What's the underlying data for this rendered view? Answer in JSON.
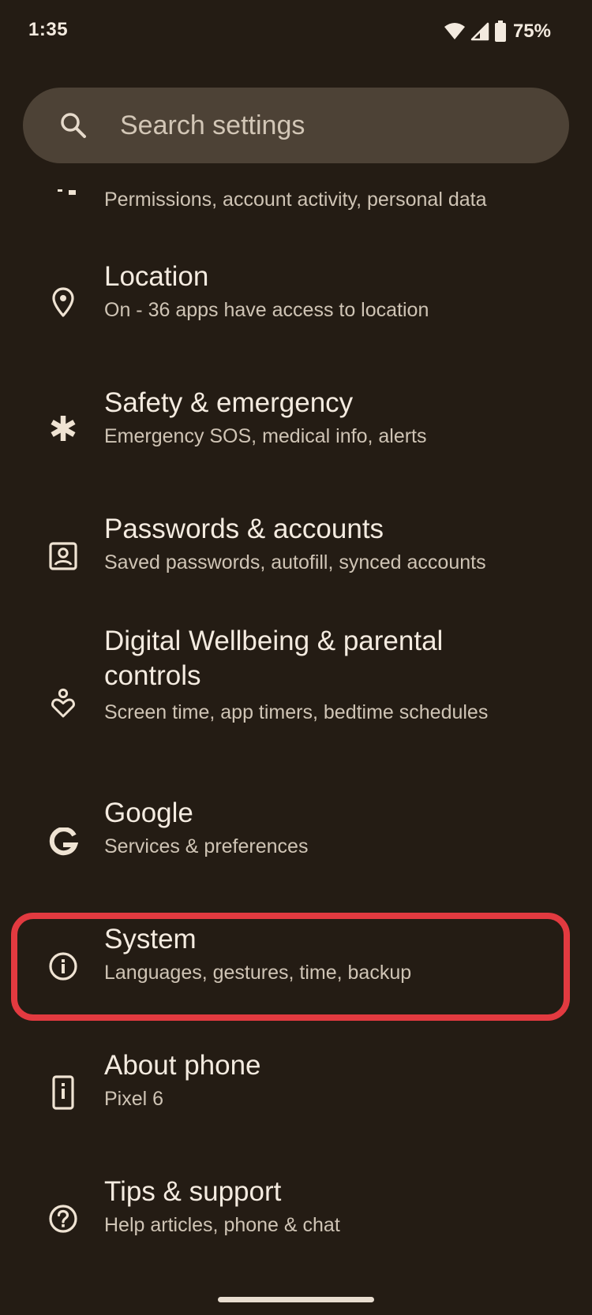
{
  "status_bar": {
    "time": "1:35",
    "battery": "75%",
    "icons": [
      "wifi-icon",
      "cell-signal-icon",
      "battery-icon"
    ]
  },
  "search": {
    "placeholder": "Search settings",
    "icon": "search-icon"
  },
  "settings": [
    {
      "name": "privacy",
      "title": "",
      "subtitle": "Permissions, account activity, personal data",
      "icon": "privacy-icon"
    },
    {
      "name": "location",
      "title": "Location",
      "subtitle": "On - 36 apps have access to location",
      "icon": "location-pin-icon"
    },
    {
      "name": "safety",
      "title": "Safety & emergency",
      "subtitle": "Emergency SOS, medical info, alerts",
      "icon": "asterisk-icon"
    },
    {
      "name": "passwords",
      "title": "Passwords & accounts",
      "subtitle": "Saved passwords, autofill, synced accounts",
      "icon": "account-box-icon"
    },
    {
      "name": "digital-wellbeing",
      "title_line1": "Digital Wellbeing & parental",
      "title_line2": "controls",
      "subtitle": "Screen time, app timers, bedtime schedules",
      "icon": "wellbeing-icon"
    },
    {
      "name": "google",
      "title": "Google",
      "subtitle": "Services & preferences",
      "icon": "google-g-icon"
    },
    {
      "name": "system",
      "title": "System",
      "subtitle": "Languages, gestures, time, backup",
      "icon": "info-icon",
      "highlighted": true
    },
    {
      "name": "about-phone",
      "title": "About phone",
      "subtitle": "Pixel 6",
      "icon": "phone-icon"
    },
    {
      "name": "tips",
      "title": "Tips & support",
      "subtitle": "Help articles, phone & chat",
      "icon": "help-circle-icon"
    }
  ],
  "colors": {
    "background": "#241c14",
    "search_background": "#4d4236",
    "highlight": "#e23a40",
    "primary_text": "#f4ebe0",
    "secondary_text": "#cfc4b5"
  }
}
